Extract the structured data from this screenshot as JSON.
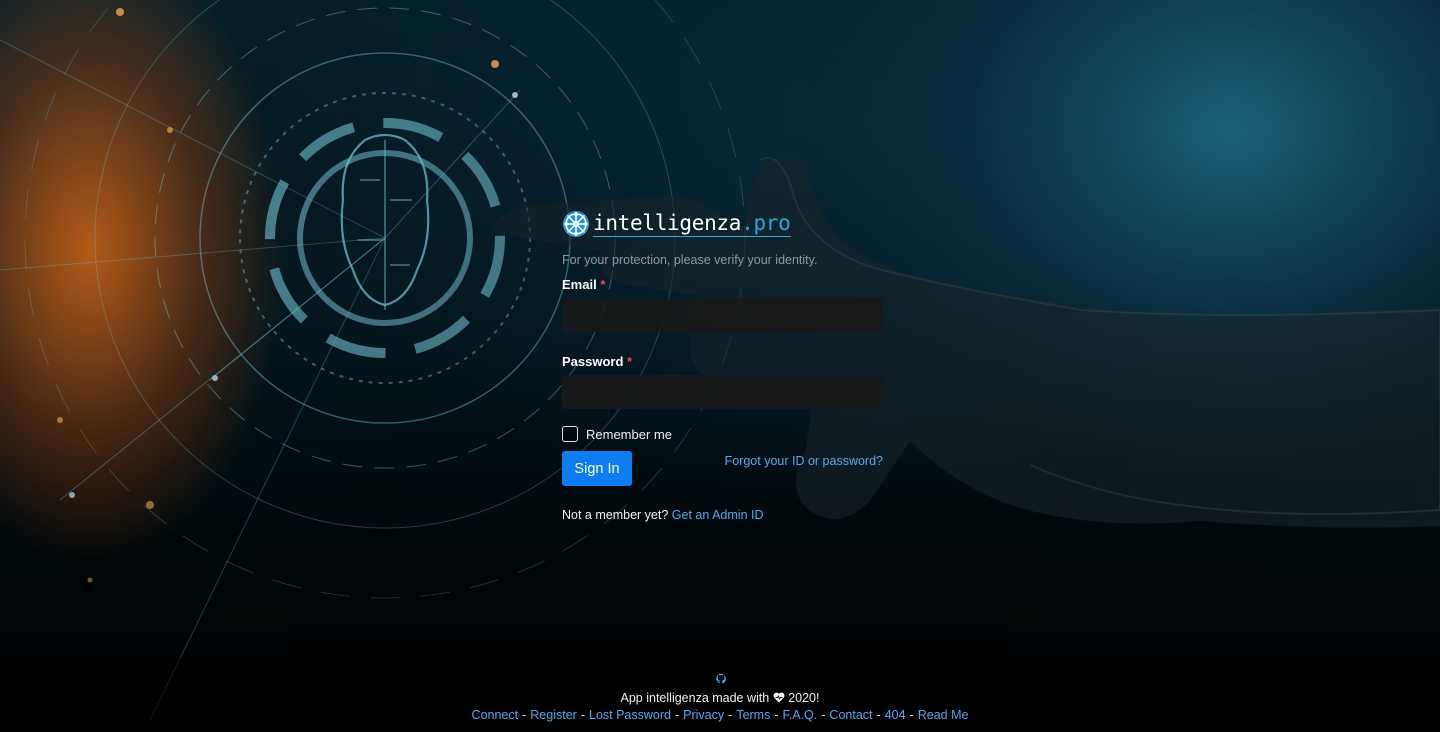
{
  "brand": {
    "name_main": "intelligenza",
    "name_suffix": ".pro"
  },
  "login": {
    "subtitle": "For your protection, please verify your identity.",
    "email_label": "Email",
    "password_label": "Password",
    "required_marker": "*",
    "email_value": "",
    "password_value": "",
    "remember_label": "Remember me",
    "remember_checked": false,
    "signin_label": "Sign In",
    "forgot_label": "Forgot your ID or password?",
    "member_prompt": "Not a member yet?",
    "member_link": "Get an Admin ID"
  },
  "footer": {
    "made_before": "App intelligenza made with",
    "made_after": "2020!",
    "links": [
      "Connect",
      "Register",
      "Lost Password",
      "Privacy",
      "Terms",
      "F.A.Q.",
      "Contact",
      "404",
      "Read Me"
    ],
    "separator": "-"
  },
  "colors": {
    "accent": "#0d7cf2",
    "link": "#5aa6ee",
    "required": "#e14a4a",
    "brand_suffix": "#2aa8e0"
  },
  "icons": {
    "logo": "brain-network-icon",
    "footer": "github-icon",
    "heart": "heart-icon"
  }
}
